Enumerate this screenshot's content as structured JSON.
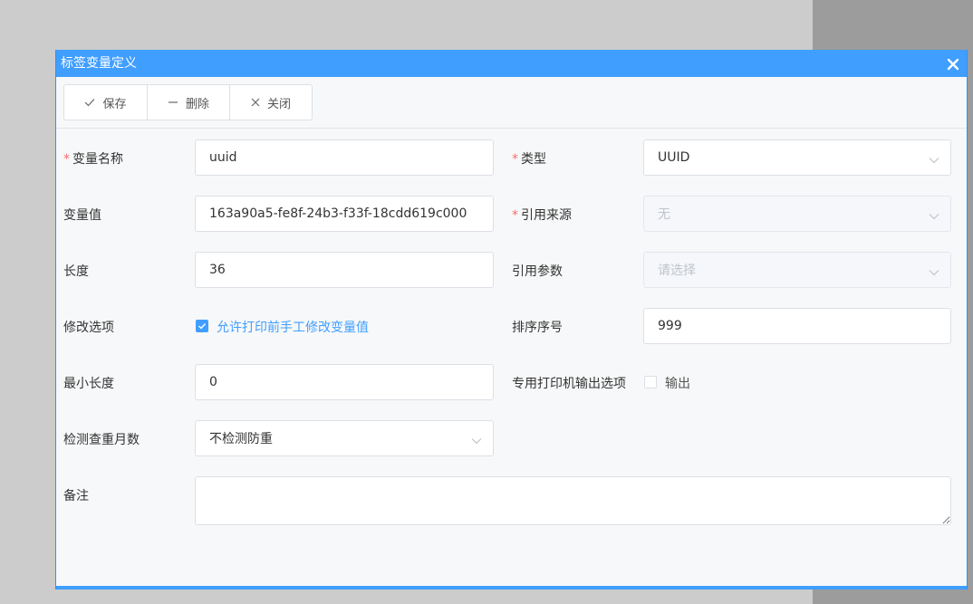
{
  "dialog": {
    "title": "标签变量定义"
  },
  "toolbar": {
    "save_label": "保存",
    "delete_label": "删除",
    "close_label": "关闭"
  },
  "form": {
    "var_name": {
      "label": "变量名称",
      "value": "uuid",
      "required": "*"
    },
    "type": {
      "label": "类型",
      "value": "UUID",
      "required": "*"
    },
    "var_value": {
      "label": "变量值",
      "value": "163a90a5-fe8f-24b3-f33f-18cdd619c000"
    },
    "ref_source": {
      "label": "引用来源",
      "value": "无",
      "required": "*"
    },
    "length": {
      "label": "长度",
      "value": "36"
    },
    "ref_param": {
      "label": "引用参数",
      "placeholder": "请选择"
    },
    "modify_option": {
      "label": "修改选项",
      "checkbox_label": "允许打印前手工修改变量值",
      "checked": true
    },
    "sort_no": {
      "label": "排序序号",
      "value": "999"
    },
    "min_length": {
      "label": "最小长度",
      "value": "0"
    },
    "printer_output": {
      "label": "专用打印机输出选项",
      "checkbox_label": "输出",
      "checked": false
    },
    "dup_months": {
      "label": "检测查重月数",
      "value": "不检测防重"
    },
    "remark": {
      "label": "备注",
      "value": ""
    }
  },
  "colors": {
    "primary": "#409eff",
    "required": "#f56c6c"
  }
}
